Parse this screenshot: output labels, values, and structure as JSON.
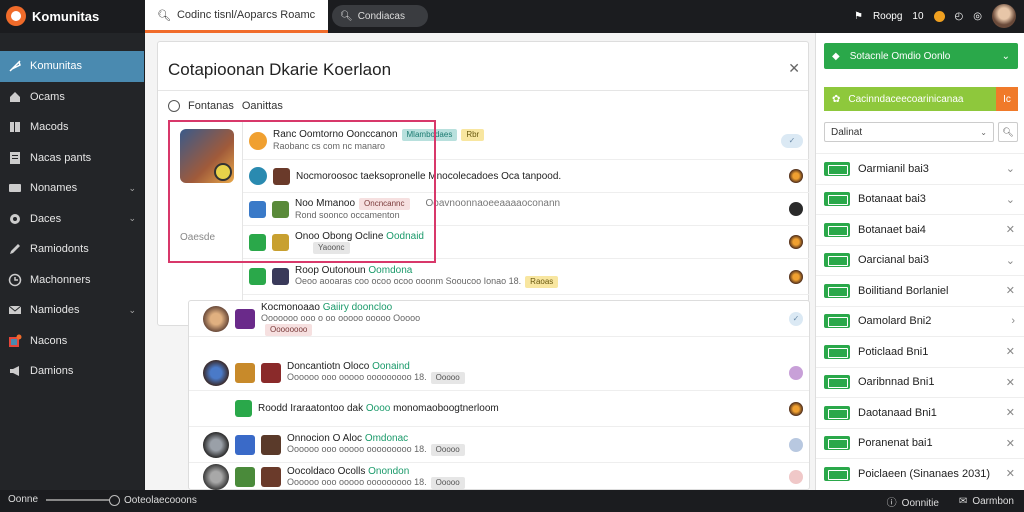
{
  "app": {
    "title": "Komunitas"
  },
  "topbar": {
    "active_tab": "Codinc tisnl/Aoparcs Roamc",
    "search_label": "Condiacas",
    "points_label": "Roopg",
    "points_value": "10"
  },
  "sidebar": {
    "items": [
      {
        "label": "Komunitas",
        "icon": "feather-icon",
        "active": true,
        "chevron": false
      },
      {
        "label": "Ocams",
        "icon": "home-icon",
        "active": false,
        "chevron": false
      },
      {
        "label": "Macods",
        "icon": "book-icon",
        "active": false,
        "chevron": false
      },
      {
        "label": "Nacas pants",
        "icon": "document-icon",
        "active": false,
        "chevron": false
      },
      {
        "label": "Nonames",
        "icon": "grid-icon",
        "active": false,
        "chevron": true
      },
      {
        "label": "Daces",
        "icon": "gear-icon",
        "active": false,
        "chevron": true
      },
      {
        "label": "Ramiodonts",
        "icon": "pen-icon",
        "active": false,
        "chevron": false
      },
      {
        "label": "Machonners",
        "icon": "clock-icon",
        "active": false,
        "chevron": false
      },
      {
        "label": "Namiodes",
        "icon": "mail-icon",
        "active": false,
        "chevron": true
      },
      {
        "label": "Nacons",
        "icon": "notification-icon",
        "active": false,
        "chevron": false
      },
      {
        "label": "Damions",
        "icon": "megaphone-icon",
        "active": false,
        "chevron": false
      }
    ]
  },
  "main": {
    "card_title": "Cotapioonan Dkarie Koerlaon",
    "filter_left": "Fontanas",
    "filter_right": "Oanittas",
    "left_label": "Oaesde",
    "thread_rows": [
      {
        "title": "Ranc Oomtorno Oonccanon",
        "sub": "Raobanc cs com nc manaro",
        "tag1": "Mlambodaes",
        "tag2": "Rbr"
      },
      {
        "title": "Nocmoroosoc taeksopronelle Mnocolecadoes Oca tanpood."
      },
      {
        "title": "Noo Mmanoo",
        "sub": "Rond soonco occamenton",
        "tag1": "Oncncannc",
        "tail": "Ooavnoonnaoeeaaaaoconann"
      },
      {
        "title": "Onoo Obong Ocline",
        "name": "Oodnaid",
        "tag1": "Yaoonc"
      },
      {
        "title": "Roop Outonoun",
        "name": "Oomdona",
        "sub": "Oeoo aooaras coo ocoo ocoo ooonm Sooucoo Ionao 18.",
        "tag1": "Raoas"
      }
    ],
    "bottom_rows": [
      {
        "title": "Kocmonoaao",
        "name": "Gaiiry dooncloo",
        "sub": "Ooooooo ooo o oo ooooo ooooo Ooooo",
        "tag1": "Oooooooo"
      },
      {
        "title": "Doncantiotn Oloco",
        "name": "Oonaind",
        "sub": "Oooooo ooo ooooo ooooooooo 18.",
        "tag1": "Ooooo"
      },
      {
        "title": "Roodd Iraraatontoo dak",
        "name": "Oooo",
        "tail": "monomaoboogtnerloom"
      },
      {
        "title": "Onnocion O Aloc",
        "name": "Omdonac",
        "sub": "Oooooo ooo ooooo ooooooooo 18.",
        "tag1": "Ooooo"
      },
      {
        "title": "Oocoldaco Ocolls",
        "name": "Onondon",
        "sub": "Oooooo ooo ooooo ooooooooo 18.",
        "tag1": "Ooooo"
      }
    ]
  },
  "rightpanel": {
    "primary_btn": "Sotacnle Omdio Oonlo",
    "secondary_btn": "Cacinndaceecoarinicanaa",
    "secondary_side": "Ic",
    "select_value": "Dalinat",
    "items": [
      {
        "label": "Oarmianil bai3",
        "action": "chevron"
      },
      {
        "label": "Botanaat bai3",
        "action": "chevron"
      },
      {
        "label": "Botanaet bai4",
        "action": "close"
      },
      {
        "label": "Oarcianal bai3",
        "action": "chevron"
      },
      {
        "label": "Boilitiand Borlaniel",
        "action": "close"
      },
      {
        "label": "Oamolard Bni2",
        "action": "chevron"
      },
      {
        "label": "Poticlaad Bni1",
        "action": "close"
      },
      {
        "label": "Oaribnnad Bni1",
        "action": "close"
      },
      {
        "label": "Daotanaad Bni1",
        "action": "close"
      },
      {
        "label": "Poranenat bai1",
        "action": "close"
      },
      {
        "label": "Poiclaeen (Sinanaes 2031)",
        "action": "close"
      }
    ]
  },
  "bottombar": {
    "left_label": "Oonne",
    "status": "Ooteolaecooons",
    "right1": "Oonnitie",
    "right2": "Oarmbon"
  },
  "colors": {
    "accent": "#f06b2a",
    "sidebar_active": "#4a8ab0",
    "green": "#2aa84a",
    "highlight": "#d8386a"
  }
}
